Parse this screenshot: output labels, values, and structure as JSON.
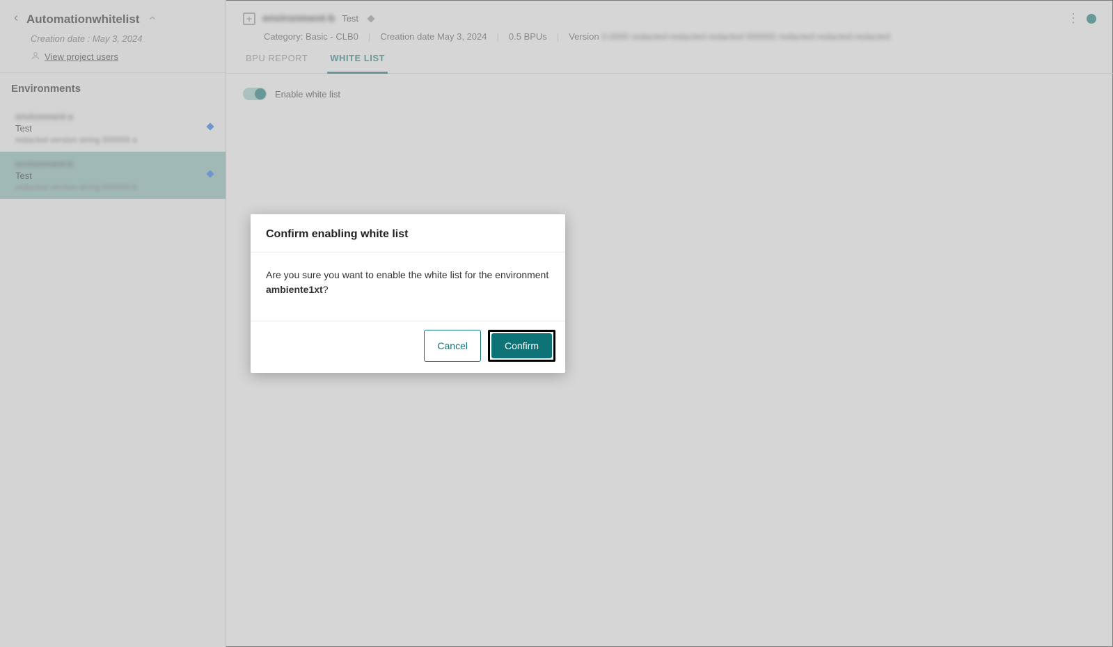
{
  "sidebar": {
    "title": "Automationwhitelist",
    "creation_label": "Creation date :",
    "creation_value": "May 3, 2024",
    "users_link": "View project users",
    "environments_label": "Environments",
    "items": [
      {
        "name": "environment-a",
        "type": "Test",
        "version": "redacted version string 000000 a"
      },
      {
        "name": "environment-b",
        "type": "Test",
        "version": "redacted version string 000000 b"
      }
    ]
  },
  "header": {
    "name": "environment-b",
    "badge": "Test",
    "meta": {
      "category_label": "Category:",
      "category_value": "Basic - CLB0",
      "creation_label": "Creation date",
      "creation_value": "May 3, 2024",
      "bpus": "0.5 BPUs",
      "version_label": "Version",
      "version_value": "0.0000 redacted-redacted-redacted 000000 redacted-redacted-redacted"
    }
  },
  "tabs": {
    "bpu": "BPU REPORT",
    "whitelist": "WHITE LIST"
  },
  "toggle": {
    "label": "Enable white list"
  },
  "dialog": {
    "title": "Confirm enabling white list",
    "body_prefix": "Are you sure you want to enable the white list for the environment ",
    "env_name": "ambiente1xt",
    "body_suffix": "?",
    "cancel": "Cancel",
    "confirm": "Confirm"
  }
}
